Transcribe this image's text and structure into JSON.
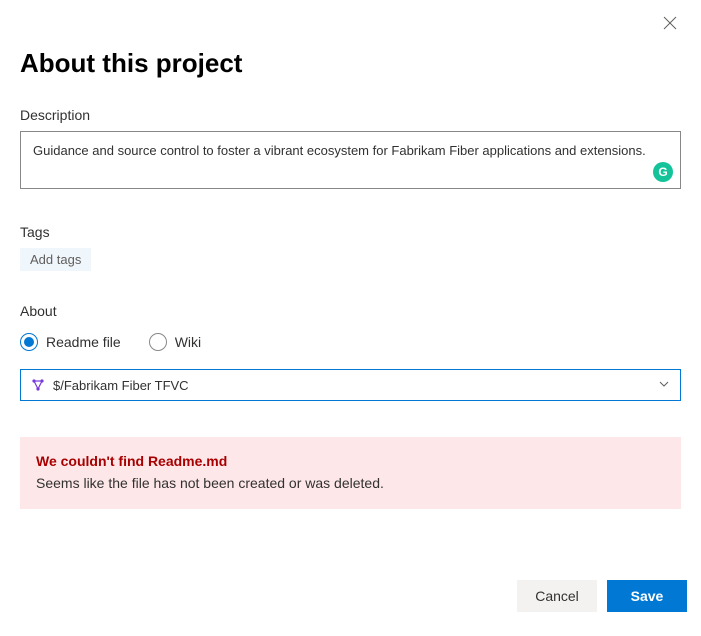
{
  "dialog": {
    "title": "About this project"
  },
  "description": {
    "label": "Description",
    "value": "Guidance and source control to foster a vibrant ecosystem for Fabrikam Fiber applications and extensions."
  },
  "tags": {
    "label": "Tags",
    "add_placeholder": "Add tags"
  },
  "about": {
    "label": "About",
    "options": {
      "readme": "Readme file",
      "wiki": "Wiki"
    },
    "selected": "readme",
    "repo": {
      "path": "$/Fabrikam Fiber TFVC"
    }
  },
  "error": {
    "title": "We couldn't find Readme.md",
    "body": "Seems like the file has not been created or was deleted."
  },
  "footer": {
    "cancel": "Cancel",
    "save": "Save"
  },
  "grammarly": {
    "letter": "G"
  }
}
